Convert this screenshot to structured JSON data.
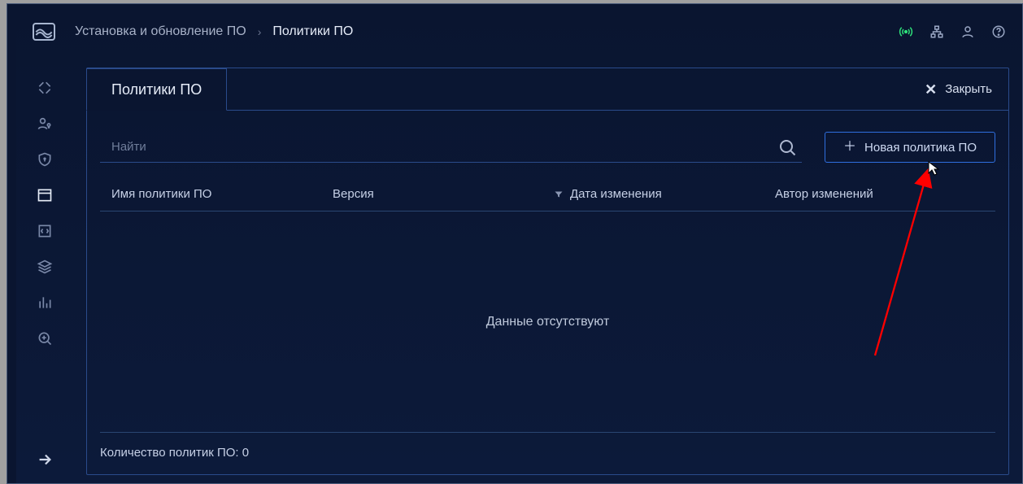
{
  "breadcrumb": {
    "parent": "Установка и обновление ПО",
    "current": "Политики ПО"
  },
  "tab": {
    "label": "Политики ПО"
  },
  "close_label": "Закрыть",
  "search": {
    "placeholder": "Найти"
  },
  "new_button": {
    "label": "Новая политика ПО"
  },
  "table": {
    "columns": {
      "name": "Имя политики ПО",
      "version": "Версия",
      "date": "Дата изменения",
      "author": "Автор изменений"
    }
  },
  "empty_text": "Данные отсутствуют",
  "footer": {
    "count_label": "Количество политик ПО:",
    "count_value": "0"
  }
}
